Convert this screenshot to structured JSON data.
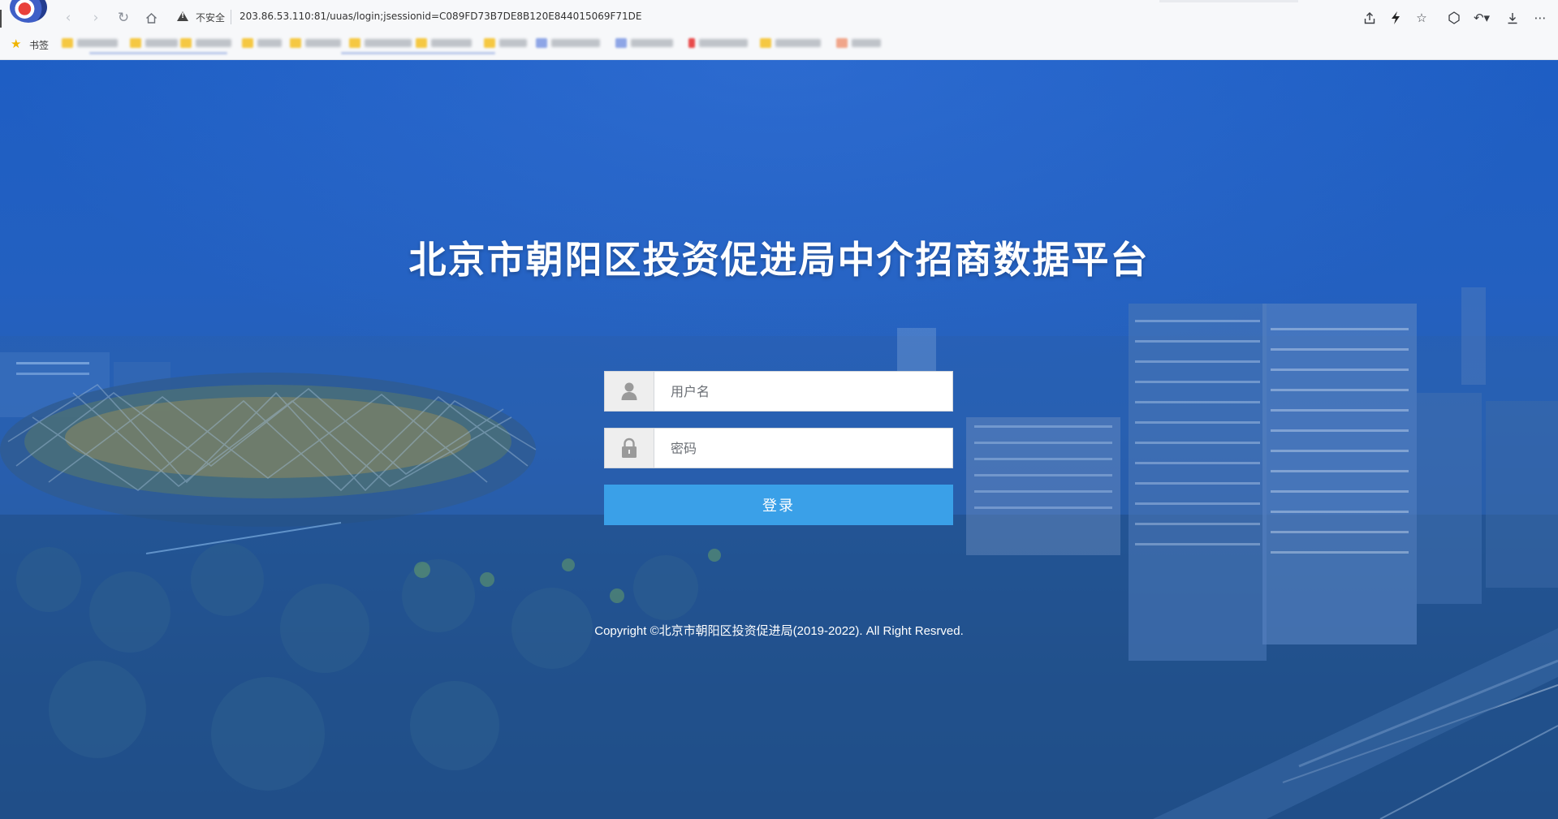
{
  "browser": {
    "security_label": "不安全",
    "url": "203.86.53.110:81/uuas/login;jsessionid=C089FD73B7DE8B120E844015069F71DE",
    "bookmarks_label": "书签",
    "nav_icons": [
      "back-icon",
      "forward-icon",
      "reload-icon",
      "home-icon"
    ],
    "right_icons": [
      "share-icon",
      "lightning-icon",
      "star-icon",
      "extensions-icon",
      "undo-icon",
      "download-icon",
      "more-icon"
    ]
  },
  "page": {
    "title": "北京市朝阳区投资促进局中介招商数据平台",
    "username_placeholder": "用户名",
    "password_placeholder": "密码",
    "login_label": "登录",
    "copyright": "Copyright ©北京市朝阳区投资促进局(2019-2022). All Right Resrved."
  },
  "colors": {
    "background_blue": "#2361bd",
    "login_button": "#3aa0e8",
    "field_icon_bg": "#eeeeee"
  }
}
